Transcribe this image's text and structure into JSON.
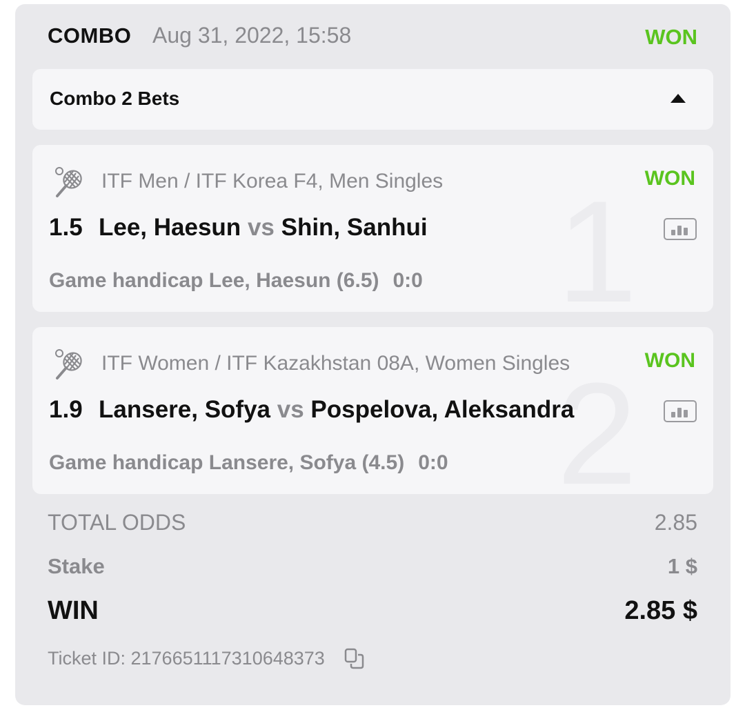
{
  "header": {
    "type": "COMBO",
    "date": "Aug 31, 2022, 15:58",
    "status": "WON",
    "status_color": "#5ac41f"
  },
  "group": {
    "title": "Combo 2 Bets",
    "toggle_icon": "caret-up-icon"
  },
  "bets": [
    {
      "index": "1",
      "sport_icon": "tennis-icon",
      "league": "ITF Men / ITF Korea F4, Men Singles",
      "status": "WON",
      "odds": "1.5",
      "team1": "Lee, Haesun",
      "vs": "vs",
      "team2": "Shin, Sanhui",
      "market": "Game handicap Lee, Haesun (6.5)",
      "score": "0:0",
      "stats_icon": "stats-icon"
    },
    {
      "index": "2",
      "sport_icon": "tennis-icon",
      "league": "ITF Women / ITF Kazakhstan 08A, Women Singles",
      "status": "WON",
      "odds": "1.9",
      "team1": "Lansere, Sofya",
      "vs": "vs",
      "team2": "Pospelova, Aleksandra",
      "market": "Game handicap Lansere, Sofya (4.5)",
      "score": "0:0",
      "stats_icon": "stats-icon"
    }
  ],
  "summary": {
    "total_odds_label": "TOTAL ODDS",
    "total_odds": "2.85",
    "stake_label": "Stake",
    "stake": "1 $",
    "win_label": "WIN",
    "win": "2.85 $"
  },
  "ticket": {
    "text": "Ticket ID: 2176651117310648373",
    "copy_icon": "copy-icon"
  }
}
